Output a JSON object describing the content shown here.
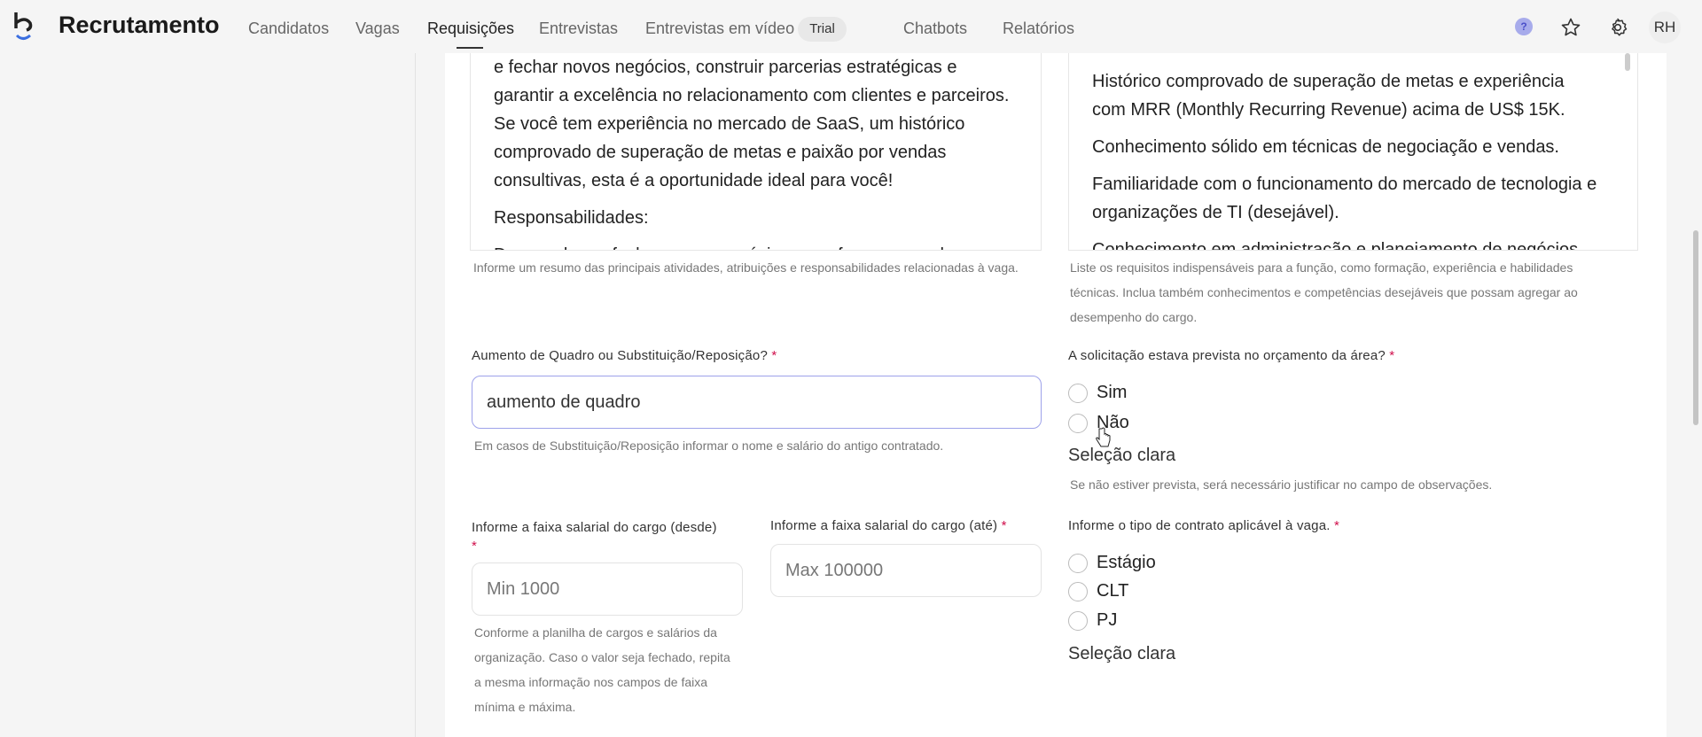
{
  "header": {
    "brand": "Recrutamento",
    "nav": [
      "Candidatos",
      "Vagas",
      "Requisições",
      "Entrevistas",
      "Entrevistas em vídeo",
      "Chatbots",
      "Relatórios"
    ],
    "active": "Requisições",
    "trial_badge": "Trial",
    "help": "?",
    "avatar": "RH"
  },
  "description": {
    "paragraphs": [
      "e fechar novos negócios, construir parcerias estratégicas e garantir a excelência no relacionamento com clientes e parceiros. Se você tem experiência no mercado de SaaS, um histórico comprovado de superação de metas e paixão por vendas consultivas, esta é a oportunidade ideal para você!",
      "Responsabilidades:",
      "Desenvolver e fechar novos negócios, com foco em vendas"
    ],
    "help": "Informe um resumo das principais atividades, atribuições e responsabilidades relacionadas à vaga."
  },
  "requirements": {
    "paragraphs": [
      "Histórico comprovado de superação de metas e experiência com MRR (Monthly Recurring Revenue) acima de US$ 15K.",
      "Conhecimento sólido em técnicas de negociação e vendas.",
      "Familiaridade com o funcionamento do mercado de tecnologia e organizações de TI (desejável).",
      "Conhecimento em administração e planejamento de negócios"
    ],
    "help": "Liste os requisitos indispensáveis para a função, como formação, experiência e habilidades técnicas. Inclua também conhecimentos e competências desejáveis que possam agregar ao desempenho do cargo."
  },
  "headcount": {
    "label": "Aumento de Quadro ou Substituição/Reposição?",
    "value": "aumento de quadro",
    "help": "Em casos de Substituição/Reposição informar o nome e salário do antigo contratado."
  },
  "budget": {
    "label": "A solicitação estava prevista no orçamento da área?",
    "options": [
      "Sim",
      "Não"
    ],
    "clear": "Seleção clara",
    "help": "Se não estiver prevista, será necessário justificar no campo de observações."
  },
  "salary_min": {
    "label": "Informe a faixa salarial do cargo (desde)",
    "placeholder": "Min 1000",
    "help": "Conforme a planilha de cargos e salários da organização. Caso o valor seja fechado, repita a mesma informação nos campos de faixa mínima e máxima."
  },
  "salary_max": {
    "label": "Informe a faixa salarial do cargo (até)",
    "placeholder": "Max 100000"
  },
  "contract": {
    "label": "Informe o tipo de contrato aplicável à vaga.",
    "options": [
      "Estágio",
      "CLT",
      "PJ"
    ],
    "clear": "Seleção clara"
  },
  "required_mark": "*"
}
